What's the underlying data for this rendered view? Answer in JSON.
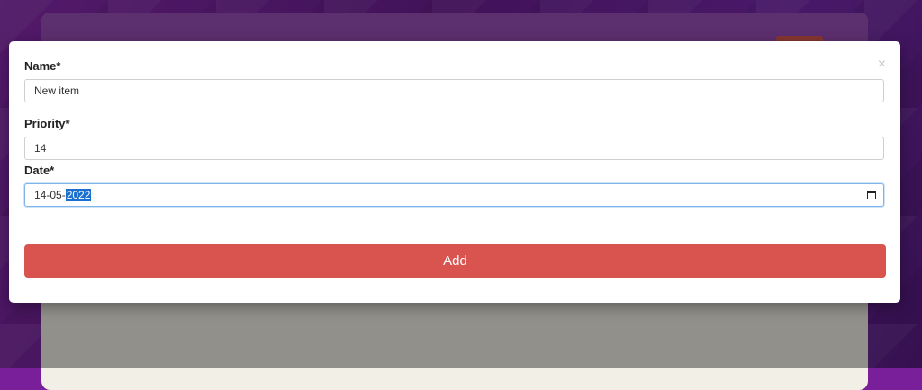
{
  "modal": {
    "close_symbol": "×",
    "fields": {
      "name": {
        "label": "Name*",
        "value": "New item"
      },
      "priority": {
        "label": "Priority*",
        "value": "14"
      },
      "date": {
        "label": "Date*",
        "value_prefix": "14-05-",
        "value_selected": "2022"
      }
    },
    "submit_label": "Add"
  },
  "colors": {
    "accent": "#d9534f",
    "background": "#7a1f9a"
  },
  "icons": {
    "calendar": "calendar-icon",
    "close": "close-icon"
  }
}
